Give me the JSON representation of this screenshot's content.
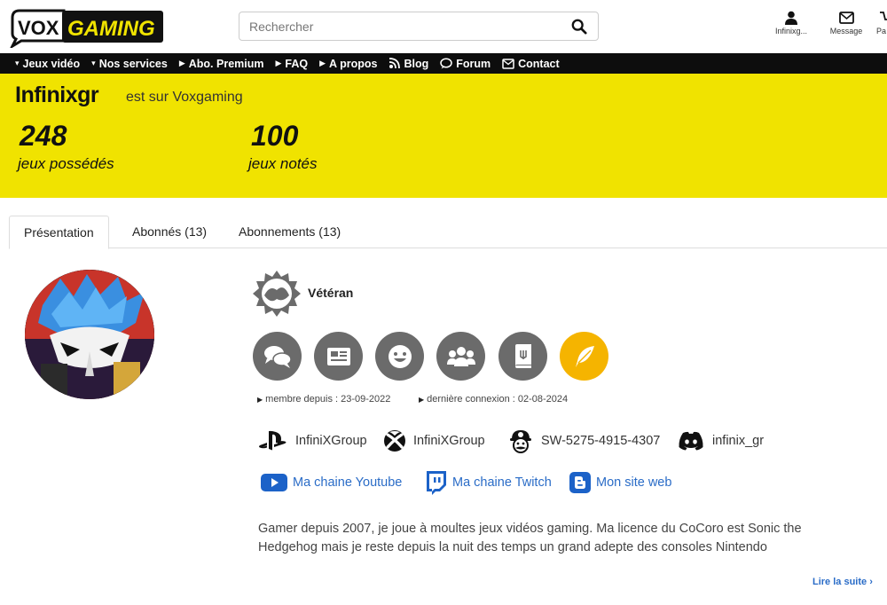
{
  "header": {
    "logo_left": "VOX",
    "logo_right": "GAMING",
    "search_placeholder": "Rechercher",
    "user_label": "Infinixg...",
    "message_label": "Message",
    "extra_label": "Pa"
  },
  "nav": {
    "items": [
      {
        "label": "Jeux vidéo"
      },
      {
        "label": "Nos services"
      },
      {
        "label": "Abo. Premium"
      },
      {
        "label": "FAQ"
      },
      {
        "label": "A propos"
      },
      {
        "label": "Blog"
      },
      {
        "label": "Forum"
      },
      {
        "label": "Contact"
      }
    ]
  },
  "banner": {
    "username": "Infinixgr",
    "subtitle": "est sur Voxgaming",
    "stats": [
      {
        "value": "248",
        "label": "jeux possédés"
      },
      {
        "value": "100",
        "label": "jeux notés"
      }
    ]
  },
  "tabs": [
    {
      "label": "Présentation",
      "active": true
    },
    {
      "label": "Abonnés (13)"
    },
    {
      "label": "Abonnements (13)"
    }
  ],
  "profile": {
    "rank": "Vétéran",
    "badges": [
      "comments-badge-icon",
      "news-badge-icon",
      "smiley-badge-icon",
      "community-badge-icon",
      "guide-badge-icon",
      "writer-badge-icon"
    ],
    "member_since": "membre depuis : 23-09-2022",
    "last_login": "dernière connexion : 02-08-2024",
    "accounts": {
      "psn": "InfiniXGroup",
      "xbox": "InfiniXGroup",
      "switch": "SW-5275-4915-4307",
      "discord": "infinix_gr"
    },
    "links": {
      "youtube": "Ma chaine Youtube",
      "twitch": "Ma chaine Twitch",
      "website": "Mon site web"
    },
    "bio_line1": "Gamer depuis 2007, je joue à moultes jeux vidéos gaming. Ma licence du CoCoro est Sonic the",
    "bio_line2": "Hedgehog mais je reste depuis la nuit des temps un grand adepte des consoles Nintendo",
    "read_more": "Lire la suite"
  },
  "colors": {
    "banner_yellow": "#f0e300",
    "nav_black": "#0d0d0d",
    "link_blue": "#2a6cc7",
    "badge_grey": "#6b6b6b",
    "badge_gold": "#f5b400"
  }
}
